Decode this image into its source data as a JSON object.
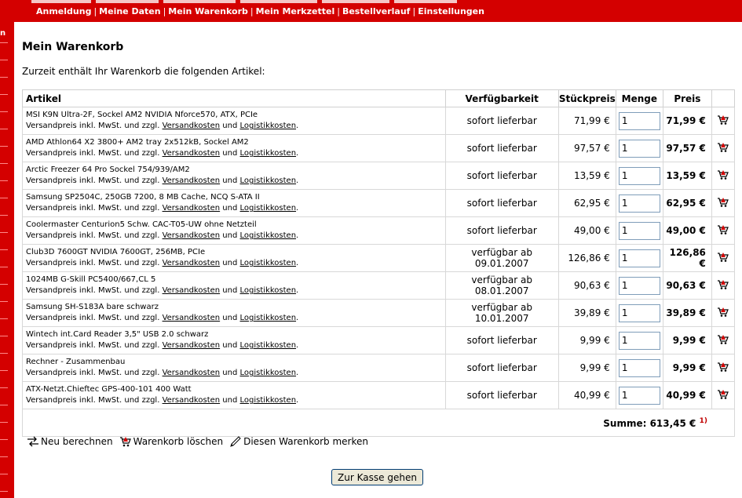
{
  "nav": {
    "items": [
      "Anmeldung",
      "Meine Daten",
      "Mein Warenkorb",
      "Mein Merkzettel",
      "Bestellverlauf",
      "Einstellungen"
    ],
    "separator": "|"
  },
  "sidebar": {
    "glyph": "n"
  },
  "page": {
    "title": "Mein Warenkorb",
    "intro": "Zurzeit enthält Ihr Warenkorb die folgenden Artikel:"
  },
  "table": {
    "headers": {
      "artikel": "Artikel",
      "verfuegbarkeit": "Verfügbarkeit",
      "stueckpreis": "Stückpreis",
      "menge": "Menge",
      "preis": "Preis"
    },
    "shipping_prefix": "Versandpreis inkl. MwSt. und zzgl.",
    "shipping_link": "Versandkosten",
    "shipping_and": "und",
    "logistics_link": "Logistikkosten",
    "rows": [
      {
        "name": "MSI K9N Ultra-2F, Sockel AM2 NVIDIA Nforce570, ATX, PCIe",
        "availability": "sofort lieferbar",
        "unit_price": "71,99 €",
        "qty": "1",
        "price": "71,99 €"
      },
      {
        "name": "AMD Athlon64 X2 3800+ AM2 tray 2x512kB, Sockel AM2",
        "availability": "sofort lieferbar",
        "unit_price": "97,57 €",
        "qty": "1",
        "price": "97,57 €"
      },
      {
        "name": "Arctic Freezer 64 Pro Sockel 754/939/AM2",
        "availability": "sofort lieferbar",
        "unit_price": "13,59 €",
        "qty": "1",
        "price": "13,59 €"
      },
      {
        "name": "Samsung SP2504C, 250GB 7200, 8 MB Cache, NCQ S-ATA II",
        "availability": "sofort lieferbar",
        "unit_price": "62,95 €",
        "qty": "1",
        "price": "62,95 €"
      },
      {
        "name": "Coolermaster Centurion5 Schw. CAC-T05-UW ohne Netzteil",
        "availability": "sofort lieferbar",
        "unit_price": "49,00 €",
        "qty": "1",
        "price": "49,00 €"
      },
      {
        "name": "Club3D 7600GT NVIDIA 7600GT, 256MB, PCIe",
        "availability": "verfügbar ab 09.01.2007",
        "unit_price": "126,86 €",
        "qty": "1",
        "price": "126,86 €"
      },
      {
        "name": "1024MB G-Skill PC5400/667,CL 5",
        "availability": "verfügbar ab 08.01.2007",
        "unit_price": "90,63 €",
        "qty": "1",
        "price": "90,63 €"
      },
      {
        "name": "Samsung SH-S183A bare schwarz",
        "availability": "verfügbar ab 10.01.2007",
        "unit_price": "39,89 €",
        "qty": "1",
        "price": "39,89 €"
      },
      {
        "name": "Wintech int.Card Reader 3,5\" USB 2.0 schwarz",
        "availability": "sofort lieferbar",
        "unit_price": "9,99 €",
        "qty": "1",
        "price": "9,99 €"
      },
      {
        "name": "Rechner - Zusammenbau",
        "availability": "sofort lieferbar",
        "unit_price": "9,99 €",
        "qty": "1",
        "price": "9,99 €"
      },
      {
        "name": "ATX-Netzt.Chieftec GPS-400-101 400 Watt",
        "availability": "sofort lieferbar",
        "unit_price": "40,99 €",
        "qty": "1",
        "price": "40,99 €"
      }
    ],
    "sum_label": "Summe: 613,45 €",
    "sum_footnote": "1)"
  },
  "actions": {
    "recalculate": "Neu berechnen",
    "clear": "Warenkorb löschen",
    "remember": "Diesen Warenkorb merken"
  },
  "checkout_label": "Zur Kasse gehen",
  "colors": {
    "brand": "#d40000",
    "accent_light": "#f2d0d0"
  }
}
